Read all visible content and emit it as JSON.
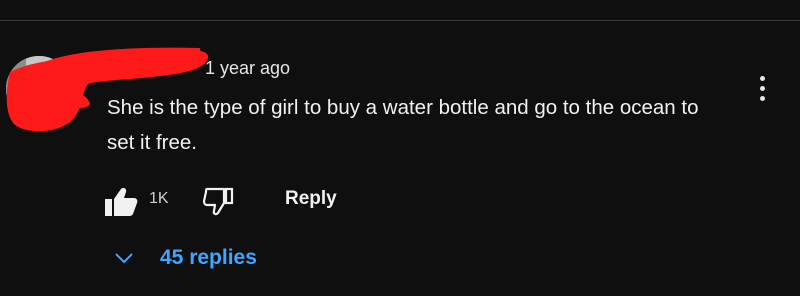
{
  "comment": {
    "timestamp": "1 year ago",
    "text": "She is the type of girl to buy a water bottle and go to the ocean to set it free.",
    "likes": "1K",
    "reply_label": "Reply",
    "replies_label": "45 replies"
  },
  "icons": {
    "like": "thumbs-up-icon",
    "dislike": "thumbs-down-icon",
    "menu": "kebab-menu-icon",
    "expand": "chevron-down-icon"
  },
  "colors": {
    "background": "#0f0f0f",
    "text": "#f1f1f1",
    "link": "#3ea6ff",
    "redaction": "#ff1a1a"
  }
}
